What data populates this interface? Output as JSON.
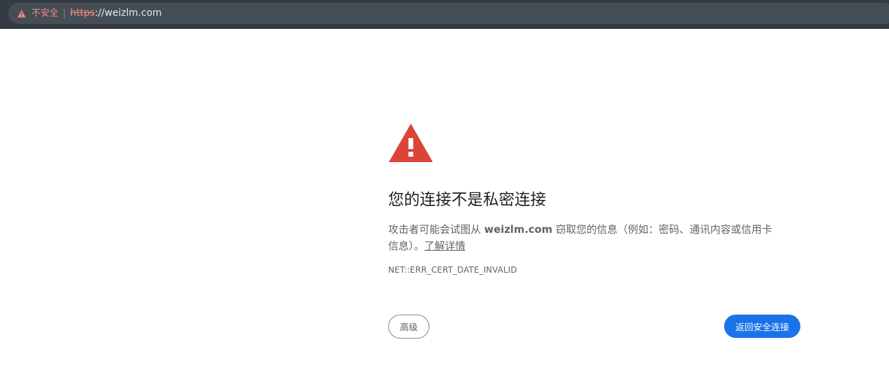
{
  "address_bar": {
    "security_label": "不安全",
    "url_scheme": "https",
    "url_rest": "://weizlm.com",
    "warning_color": "#f28b82"
  },
  "interstitial": {
    "icon": "warning-triangle-icon",
    "icon_color": "#db4437",
    "headline": "您的连接不是私密连接",
    "message_before": "攻击者可能会试图从 ",
    "domain": "weizlm.com",
    "message_after": " 窃取您的信息（例如：密码、通讯内容或信用卡信息）。",
    "learn_more": "了解详情",
    "error_code": "NET::ERR_CERT_DATE_INVALID"
  },
  "buttons": {
    "advanced_label": "高级",
    "back_label": "返回安全连接",
    "primary_color": "#1a73e8"
  }
}
